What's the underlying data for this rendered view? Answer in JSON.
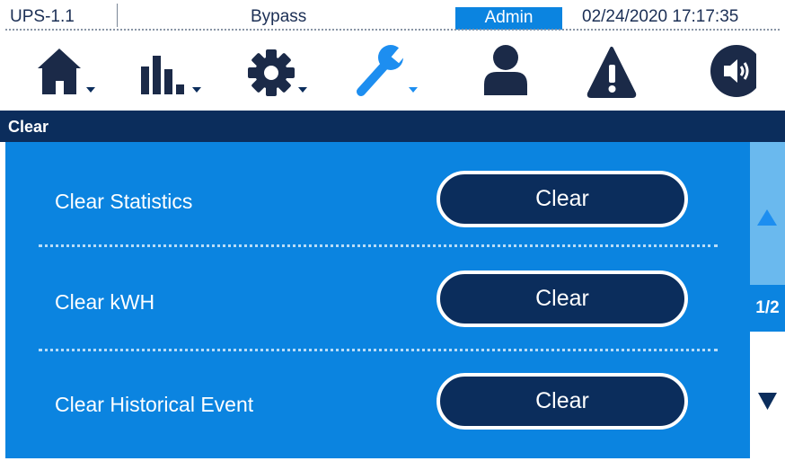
{
  "status": {
    "device": "UPS-1.1",
    "mode": "Bypass",
    "user_level": "Admin",
    "datetime": "02/24/2020  17:17:35"
  },
  "nav": {
    "items": [
      {
        "icon": "home-icon",
        "has_dropdown": true
      },
      {
        "icon": "bar-chart-icon",
        "has_dropdown": true
      },
      {
        "icon": "gear-icon",
        "has_dropdown": true
      },
      {
        "icon": "wrench-icon",
        "has_dropdown": true,
        "active": true
      },
      {
        "icon": "user-icon",
        "has_dropdown": false
      },
      {
        "icon": "warning-icon",
        "has_dropdown": false
      },
      {
        "icon": "speaker-icon",
        "has_dropdown": false
      }
    ]
  },
  "page": {
    "title": "Clear",
    "rows": [
      {
        "label": "Clear Statistics",
        "button": "Clear"
      },
      {
        "label": "Clear kWH",
        "button": "Clear"
      },
      {
        "label": "Clear Historical Event",
        "button": "Clear"
      }
    ],
    "page_indicator": "1/2"
  },
  "colors": {
    "navy": "#0b2d5c",
    "accent_blue": "#0b84e0",
    "light_blue": "#6ab9ee"
  }
}
